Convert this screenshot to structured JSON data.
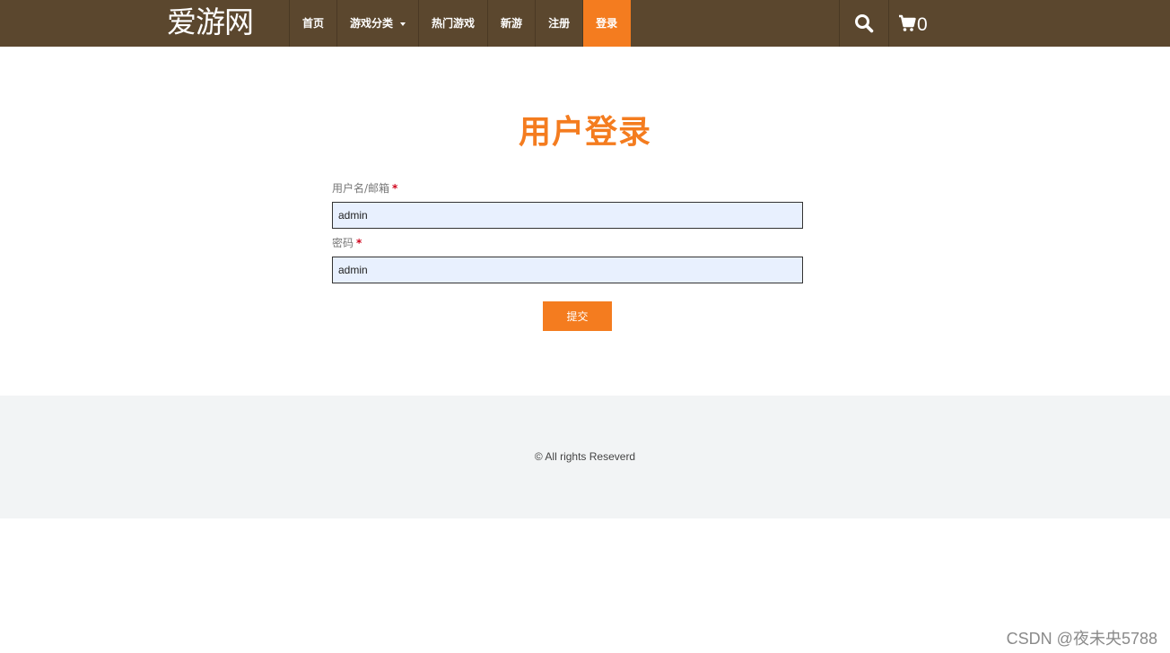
{
  "brand": {
    "name": "爱游网"
  },
  "nav": {
    "items": [
      {
        "label": "首页"
      },
      {
        "label": "游戏分类"
      },
      {
        "label": "热门游戏"
      },
      {
        "label": "新游"
      },
      {
        "label": "注册"
      },
      {
        "label": "登录"
      }
    ],
    "active_item": "登录",
    "cart_count": "0",
    "icons": {
      "search": "search-icon",
      "cart": "cart-icon",
      "dropdown": "caret-down-icon"
    }
  },
  "login": {
    "title": "用户登录",
    "username_label": "用户名/邮箱",
    "username_value": "admin",
    "password_label": "密码",
    "password_value": "admin",
    "required_mark": "*",
    "submit_label": "提交"
  },
  "footer": {
    "copyright": "© All rights Reseverd"
  },
  "watermark": "CSDN @夜未央5788",
  "colors": {
    "navbar_bg": "#5b472e",
    "accent": "#f47c1f",
    "input_bg": "#e8f0fe",
    "footer_bg": "#f2f4f5"
  }
}
